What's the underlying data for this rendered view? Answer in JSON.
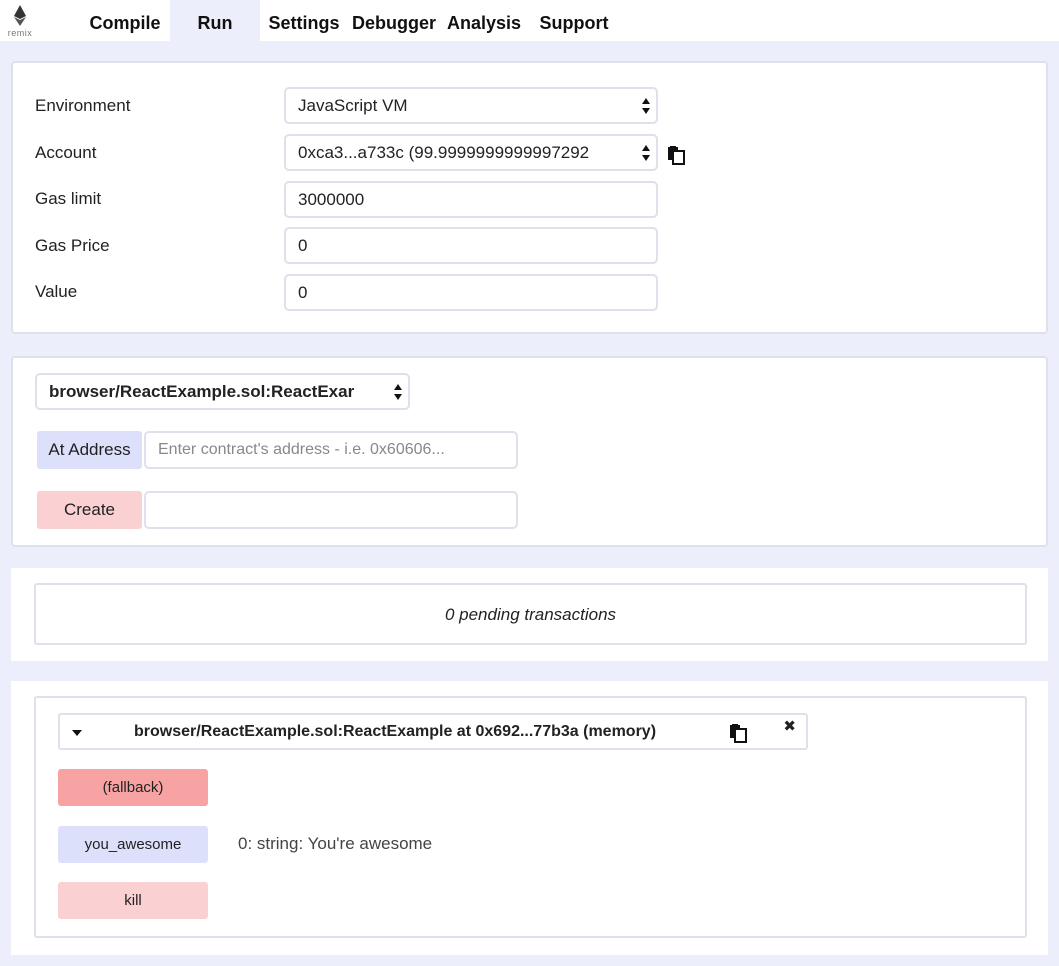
{
  "nav": {
    "logo_text": "remix",
    "tabs": [
      {
        "label": "Compile"
      },
      {
        "label": "Run",
        "active": true
      },
      {
        "label": "Settings"
      },
      {
        "label": "Debugger"
      },
      {
        "label": "Analysis"
      },
      {
        "label": "Support"
      }
    ]
  },
  "run": {
    "environment_label": "Environment",
    "environment_value": "JavaScript VM",
    "account_label": "Account",
    "account_value": "0xca3...a733c (99.9999999999997292",
    "gas_limit_label": "Gas limit",
    "gas_limit_value": "3000000",
    "gas_price_label": "Gas Price",
    "gas_price_value": "0",
    "value_label": "Value",
    "value_value": "0"
  },
  "contract": {
    "selected": "browser/ReactExample.sol:ReactExar",
    "at_address_label": "At Address",
    "address_placeholder": "Enter contract's address - i.e. 0x60606...",
    "create_label": "Create",
    "create_args": ""
  },
  "pending": {
    "text": "0 pending transactions"
  },
  "instance": {
    "title": "browser/ReactExample.sol:ReactExample at 0x692...77b3a (memory)",
    "close_glyph": "✖",
    "functions": [
      {
        "label": "(fallback)"
      },
      {
        "label": "you_awesome",
        "result": "0: string: You're awesome"
      },
      {
        "label": "kill"
      }
    ]
  },
  "colors": {
    "page_bg": "#eceefb",
    "ataddress_bg": "#dde0fa",
    "create_bg": "#fad0d3",
    "fallback_bg": "#f7a2a3"
  },
  "icons": {
    "logo": "ethereum-icon",
    "copy": "clipboard-icon",
    "select": "select-arrows-icon",
    "collapse": "caret-down-icon",
    "close": "close-icon"
  }
}
